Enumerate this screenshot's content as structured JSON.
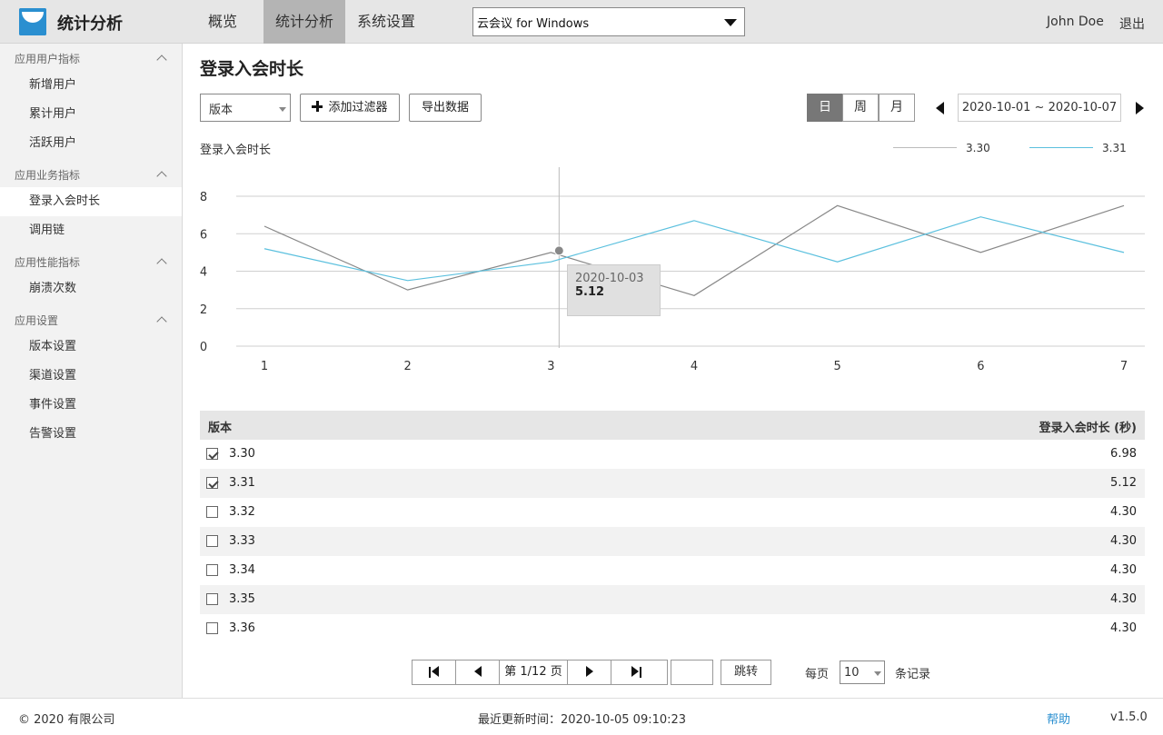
{
  "app": {
    "title": "统计分析"
  },
  "nav": {
    "tabs": [
      "概览",
      "统计分析",
      "系统设置"
    ],
    "active": 1
  },
  "product_select": {
    "value": "云会议 for Windows"
  },
  "user": {
    "name": "John Doe",
    "logout": "退出"
  },
  "sidebar": {
    "groups": [
      {
        "label": "应用用户指标",
        "items": [
          "新增用户",
          "累计用户",
          "活跃用户"
        ]
      },
      {
        "label": "应用业务指标",
        "items": [
          "登录入会时长",
          "调用链"
        ]
      },
      {
        "label": "应用性能指标",
        "items": [
          "崩溃次数"
        ]
      },
      {
        "label": "应用设置",
        "items": [
          "版本设置",
          "渠道设置",
          "事件设置",
          "告警设置"
        ]
      }
    ],
    "active_item": "登录入会时长"
  },
  "page": {
    "title": "登录入会时长"
  },
  "toolbar": {
    "version_select": "版本",
    "add_filter": "添加过滤器",
    "export": "导出数据",
    "periods": [
      "日",
      "周",
      "月"
    ],
    "active_period": "日",
    "date_range": "2020-10-01 ~ 2020-10-07"
  },
  "chart_data": {
    "type": "line",
    "title": "登录入会时长",
    "x": [
      1,
      2,
      3,
      4,
      5,
      6,
      7
    ],
    "ylim": [
      0,
      8
    ],
    "yticks": [
      0,
      2,
      4,
      6,
      8
    ],
    "grid": true,
    "legend_position": "top-right",
    "series": [
      {
        "name": "3.30",
        "color": "#888888",
        "values": [
          6.4,
          3.0,
          5.0,
          2.7,
          7.5,
          5.0,
          7.5
        ]
      },
      {
        "name": "3.31",
        "color": "#5bc0de",
        "values": [
          5.2,
          3.5,
          4.5,
          6.7,
          4.5,
          6.9,
          5.0
        ]
      }
    ],
    "tooltip": {
      "date": "2020-10-03",
      "value": "5.12",
      "x_index": 3
    }
  },
  "table": {
    "headers": [
      "版本",
      "登录入会时长 (秒)"
    ],
    "rows": [
      {
        "version": "3.30",
        "value": "6.98",
        "checked": true
      },
      {
        "version": "3.31",
        "value": "5.12",
        "checked": true
      },
      {
        "version": "3.32",
        "value": "4.30",
        "checked": false
      },
      {
        "version": "3.33",
        "value": "4.30",
        "checked": false
      },
      {
        "version": "3.34",
        "value": "4.30",
        "checked": false
      },
      {
        "version": "3.35",
        "value": "4.30",
        "checked": false
      },
      {
        "version": "3.36",
        "value": "4.30",
        "checked": false
      }
    ]
  },
  "pager": {
    "page_label": "第 1/12 页",
    "jump": "跳转",
    "per_page_label": "每页",
    "per_page_value": "10",
    "records_label": "条记录"
  },
  "footer": {
    "copyright": "© 2020 有限公司",
    "updated": "最近更新时间：2020-10-05 09:10:23",
    "help": "帮助",
    "version": "v1.5.0"
  }
}
